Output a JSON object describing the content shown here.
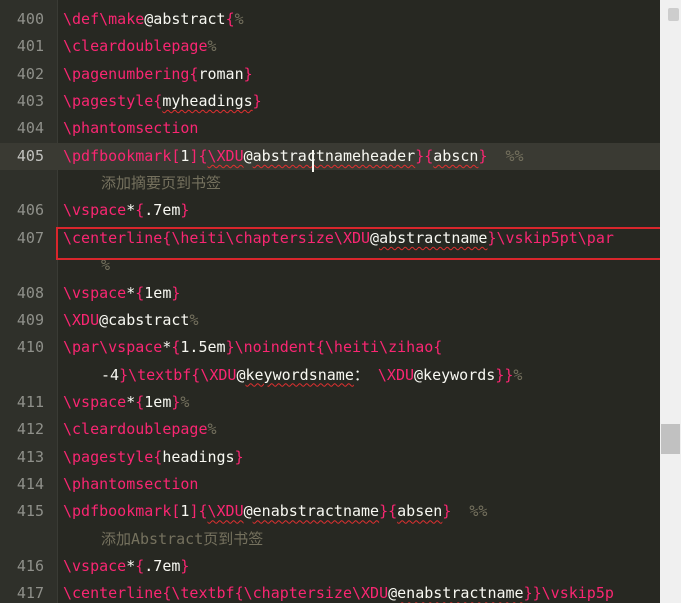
{
  "editor": {
    "lines": [
      {
        "num": "400",
        "tokens": [
          {
            "t": "cmd",
            "v": "\\def\\make"
          },
          {
            "t": "arg",
            "v": "@abstract"
          },
          {
            "t": "cmd",
            "v": "{"
          },
          {
            "t": "com",
            "v": "%"
          }
        ]
      },
      {
        "num": "401",
        "tokens": [
          {
            "t": "cmd",
            "v": "\\cleardoublepage"
          },
          {
            "t": "com",
            "v": "%"
          }
        ]
      },
      {
        "num": "402",
        "tokens": [
          {
            "t": "cmd",
            "v": "\\pagenumbering{"
          },
          {
            "t": "arg",
            "v": "roman"
          },
          {
            "t": "cmd",
            "v": "}"
          }
        ]
      },
      {
        "num": "403",
        "tokens": [
          {
            "t": "cmd",
            "v": "\\pagestyle{"
          },
          {
            "t": "arg",
            "v": "myheadings",
            "sq": true
          },
          {
            "t": "cmd",
            "v": "}"
          }
        ]
      },
      {
        "num": "404",
        "tokens": [
          {
            "t": "cmd",
            "v": "\\phantomsection"
          }
        ]
      },
      {
        "num": "405",
        "current": true,
        "tokens": [
          {
            "t": "cmd",
            "v": "\\pdfbookmark["
          },
          {
            "t": "arg",
            "v": "1"
          },
          {
            "t": "cmd",
            "v": "]{"
          },
          {
            "t": "cmd",
            "v": "\\XDU",
            "sq": true
          },
          {
            "t": "arg",
            "v": "@"
          },
          {
            "t": "arg",
            "v": "abstractnameheader",
            "sq": true
          },
          {
            "t": "cmd",
            "v": "}{"
          },
          {
            "t": "arg",
            "v": "abscn",
            "sq": true
          },
          {
            "t": "cmd",
            "v": "}"
          },
          {
            "t": "txt",
            "v": "  "
          },
          {
            "t": "com",
            "v": "%%"
          }
        ]
      },
      {
        "num": "",
        "wrap": true,
        "tokens": [
          {
            "t": "com",
            "v": "添加摘要页到书签"
          }
        ]
      },
      {
        "num": "406",
        "tokens": [
          {
            "t": "cmd",
            "v": "\\vspace"
          },
          {
            "t": "arg",
            "v": "*"
          },
          {
            "t": "cmd",
            "v": "{"
          },
          {
            "t": "arg",
            "v": ".7em"
          },
          {
            "t": "cmd",
            "v": "}"
          }
        ]
      },
      {
        "num": "407",
        "tokens": [
          {
            "t": "cmd",
            "v": "\\centerline{\\heiti\\chaptersize\\XDU"
          },
          {
            "t": "arg",
            "v": "@"
          },
          {
            "t": "arg",
            "v": "abstractname",
            "sq": true
          },
          {
            "t": "cmd",
            "v": "}\\vskip5pt\\par"
          }
        ]
      },
      {
        "num": "",
        "wrap": true,
        "tokens": [
          {
            "t": "com",
            "v": "%"
          }
        ]
      },
      {
        "num": "408",
        "tokens": [
          {
            "t": "cmd",
            "v": "\\vspace"
          },
          {
            "t": "arg",
            "v": "*"
          },
          {
            "t": "cmd",
            "v": "{"
          },
          {
            "t": "arg",
            "v": "1em"
          },
          {
            "t": "cmd",
            "v": "}"
          }
        ]
      },
      {
        "num": "409",
        "tokens": [
          {
            "t": "cmd",
            "v": "\\XDU"
          },
          {
            "t": "arg",
            "v": "@cabstract"
          },
          {
            "t": "com",
            "v": "%"
          }
        ]
      },
      {
        "num": "410",
        "tokens": [
          {
            "t": "cmd",
            "v": "\\par\\vspace"
          },
          {
            "t": "arg",
            "v": "*"
          },
          {
            "t": "cmd",
            "v": "{"
          },
          {
            "t": "arg",
            "v": "1.5em"
          },
          {
            "t": "cmd",
            "v": "}\\noindent{\\heiti\\zihao{"
          }
        ]
      },
      {
        "num": "",
        "wrap": true,
        "tokens": [
          {
            "t": "arg",
            "v": "-4"
          },
          {
            "t": "cmd",
            "v": "}\\textbf{\\XDU"
          },
          {
            "t": "arg",
            "v": "@"
          },
          {
            "t": "arg",
            "v": "keywordsname",
            "sq": true
          },
          {
            "t": "txt",
            "v": "： "
          },
          {
            "t": "cmd",
            "v": "\\XDU"
          },
          {
            "t": "arg",
            "v": "@keywords"
          },
          {
            "t": "cmd",
            "v": "}}"
          },
          {
            "t": "com",
            "v": "%"
          }
        ]
      },
      {
        "num": "411",
        "tokens": [
          {
            "t": "cmd",
            "v": "\\vspace"
          },
          {
            "t": "arg",
            "v": "*"
          },
          {
            "t": "cmd",
            "v": "{"
          },
          {
            "t": "arg",
            "v": "1em"
          },
          {
            "t": "cmd",
            "v": "}"
          },
          {
            "t": "com",
            "v": "%"
          }
        ]
      },
      {
        "num": "412",
        "tokens": [
          {
            "t": "cmd",
            "v": "\\cleardoublepage"
          },
          {
            "t": "com",
            "v": "%"
          }
        ]
      },
      {
        "num": "413",
        "tokens": [
          {
            "t": "cmd",
            "v": "\\pagestyle{"
          },
          {
            "t": "arg",
            "v": "headings"
          },
          {
            "t": "cmd",
            "v": "}"
          }
        ]
      },
      {
        "num": "414",
        "tokens": [
          {
            "t": "cmd",
            "v": "\\phantomsection"
          }
        ]
      },
      {
        "num": "415",
        "tokens": [
          {
            "t": "cmd",
            "v": "\\pdfbookmark["
          },
          {
            "t": "arg",
            "v": "1"
          },
          {
            "t": "cmd",
            "v": "]{"
          },
          {
            "t": "cmd",
            "v": "\\XDU",
            "sq": true
          },
          {
            "t": "arg",
            "v": "@"
          },
          {
            "t": "arg",
            "v": "enabstractname",
            "sq": true
          },
          {
            "t": "cmd",
            "v": "}{"
          },
          {
            "t": "arg",
            "v": "absen",
            "sq": true
          },
          {
            "t": "cmd",
            "v": "}"
          },
          {
            "t": "txt",
            "v": "  "
          },
          {
            "t": "com",
            "v": "%%"
          }
        ]
      },
      {
        "num": "",
        "wrap": true,
        "tokens": [
          {
            "t": "com",
            "v": "添加Abstract页到书签"
          }
        ]
      },
      {
        "num": "416",
        "tokens": [
          {
            "t": "cmd",
            "v": "\\vspace"
          },
          {
            "t": "arg",
            "v": "*"
          },
          {
            "t": "cmd",
            "v": "{"
          },
          {
            "t": "arg",
            "v": ".7em"
          },
          {
            "t": "cmd",
            "v": "}"
          }
        ]
      },
      {
        "num": "417",
        "tokens": [
          {
            "t": "cmd",
            "v": "\\centerline{\\textbf{\\chaptersize\\XDU"
          },
          {
            "t": "arg",
            "v": "@"
          },
          {
            "t": "arg",
            "v": "enabstractname",
            "sq": true
          },
          {
            "t": "cmd",
            "v": "}}\\vskip5p"
          }
        ]
      }
    ]
  },
  "colors": {
    "background": "#272822",
    "command": "#f92672",
    "text": "#f8f8f2",
    "comment": "#75715e",
    "line_number": "#8f908a",
    "highlight_box": "#d9262c",
    "spellcheck_squiggle": "#e03030"
  }
}
